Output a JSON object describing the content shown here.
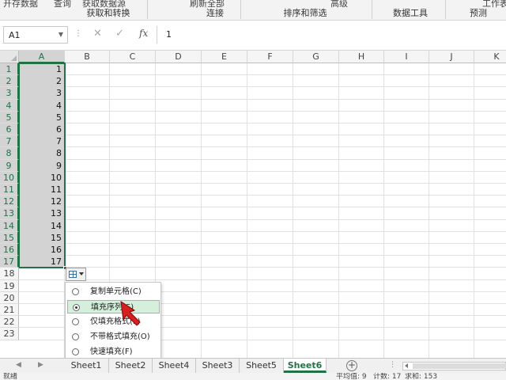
{
  "ribbon": {
    "cut_labels": [
      "开存数据",
      "查询",
      "获取数据源",
      "刷新全部",
      "高级"
    ],
    "groups": [
      "获取和转换",
      "连接",
      "排序和筛选",
      "数据工具",
      "预测"
    ],
    "right_cut": "工作表"
  },
  "formula_bar": {
    "name_box": "A1",
    "cancel_icon": "✕",
    "enter_icon": "✓",
    "fx": "fx",
    "value": "1"
  },
  "grid": {
    "columns": [
      "A",
      "B",
      "C",
      "D",
      "E",
      "F",
      "G",
      "H",
      "I",
      "J",
      "K"
    ],
    "selected_column": "A",
    "rows": [
      "1",
      "2",
      "3",
      "4",
      "5",
      "6",
      "7",
      "8",
      "9",
      "10",
      "11",
      "12",
      "13",
      "14",
      "15",
      "16",
      "17",
      "18",
      "19",
      "20",
      "21",
      "22",
      "23"
    ],
    "a_values": [
      "1",
      "2",
      "3",
      "4",
      "5",
      "6",
      "7",
      "8",
      "9",
      "10",
      "11",
      "12",
      "13",
      "14",
      "15",
      "16",
      "17"
    ]
  },
  "autofill_menu": {
    "items": [
      {
        "label": "复制单元格(C)",
        "selected": false
      },
      {
        "label": "填充序列(S)",
        "selected": true
      },
      {
        "label": "仅填充格式(F)",
        "selected": false
      },
      {
        "label": "不带格式填充(O)",
        "selected": false
      },
      {
        "label": "快速填充(F)",
        "selected": false
      }
    ]
  },
  "sheet_tabs": [
    "Sheet1",
    "Sheet2",
    "Sheet4",
    "Sheet3",
    "Sheet5",
    "Sheet6"
  ],
  "active_sheet": "Sheet6",
  "status_bar": {
    "left": "就绪",
    "average": "平均值: 9",
    "count": "计数: 17",
    "sum": "求和: 153"
  },
  "colors": {
    "accent": "#217346",
    "selection": "#d3d3d3",
    "menu_highlight": "#d5efdd",
    "cursor_red": "#d62020"
  },
  "icons": [
    "cancel-icon",
    "enter-icon",
    "fx-icon",
    "autofill-options-icon",
    "radio-icon",
    "pointer-cursor-icon",
    "add-sheet-icon"
  ]
}
